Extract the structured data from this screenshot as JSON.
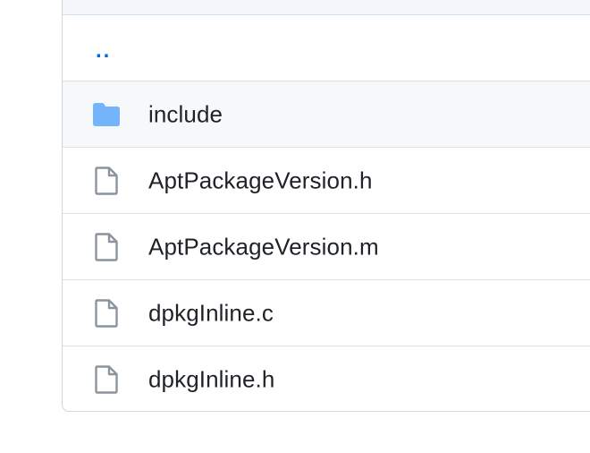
{
  "file_list": {
    "parent_link": "..",
    "rows": [
      {
        "type": "folder",
        "icon": "folder-icon",
        "name": "include"
      },
      {
        "type": "file",
        "icon": "file-icon",
        "name": "AptPackageVersion.h"
      },
      {
        "type": "file",
        "icon": "file-icon",
        "name": "AptPackageVersion.m"
      },
      {
        "type": "file",
        "icon": "file-icon",
        "name": "dpkgInline.c"
      },
      {
        "type": "file",
        "icon": "file-icon",
        "name": "dpkgInline.h"
      }
    ]
  },
  "colors": {
    "folder": "#74b4fa",
    "file_icon": "#8b949e",
    "link": "#0969da",
    "text": "#1f2328",
    "border": "#d0d7de"
  }
}
